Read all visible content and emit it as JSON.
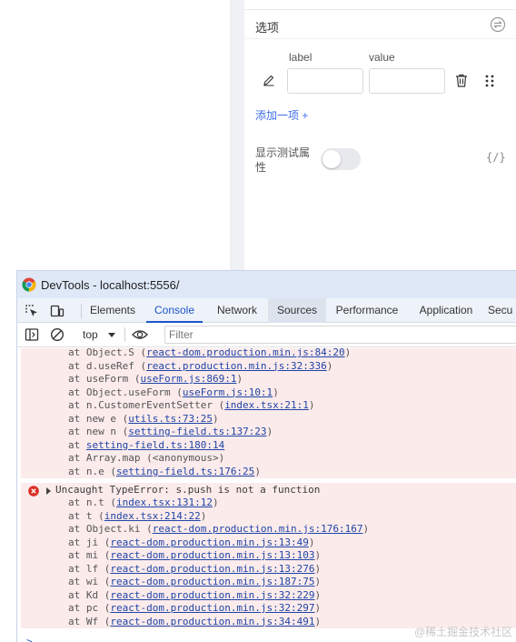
{
  "panel": {
    "section_title": "选项",
    "column_label": "label",
    "column_value": "value",
    "add_link": "添加一项 +",
    "toggle_label": "显示测试属性",
    "toggle_on": false,
    "code_icon_text": "{/}"
  },
  "devtools": {
    "title": "DevTools - localhost:5556/",
    "tabs": [
      "Elements",
      "Console",
      "Network",
      "Sources",
      "Performance",
      "Application",
      "Secu"
    ],
    "active_tab": "Console",
    "context": "top",
    "filter_placeholder": "Filter"
  },
  "console": {
    "block1": [
      {
        "pre": "at Object.S (",
        "link": "react-dom.production.min.js:84:20",
        "post": ")"
      },
      {
        "pre": "at d.useRef (",
        "link": "react.production.min.js:32:336",
        "post": ")"
      },
      {
        "pre": "at useForm (",
        "link": "useForm.js:869:1",
        "post": ")"
      },
      {
        "pre": "at Object.useForm (",
        "link": "useForm.js:10:1",
        "post": ")"
      },
      {
        "pre": "at n.CustomerEventSetter (",
        "link": "index.tsx:21:1",
        "post": ")"
      },
      {
        "pre": "at new e (",
        "link": "utils.ts:73:25",
        "post": ")"
      },
      {
        "pre": "at new n (",
        "link": "setting-field.ts:137:23",
        "post": ")"
      },
      {
        "pre": "at ",
        "link": "setting-field.ts:180:14",
        "post": ""
      },
      {
        "pre": "at Array.map (<anonymous>)",
        "link": "",
        "post": ""
      },
      {
        "pre": "at n.e (",
        "link": "setting-field.ts:176:25",
        "post": ")"
      }
    ],
    "error_message": "Uncaught TypeError: s.push is not a function",
    "block2": [
      {
        "pre": "at n.t (",
        "link": "index.tsx:131:12",
        "post": ")"
      },
      {
        "pre": "at t (",
        "link": "index.tsx:214:22",
        "post": ")"
      },
      {
        "pre": "at Object.ki (",
        "link": "react-dom.production.min.js:176:167",
        "post": ")"
      },
      {
        "pre": "at ji (",
        "link": "react-dom.production.min.js:13:49",
        "post": ")"
      },
      {
        "pre": "at mi (",
        "link": "react-dom.production.min.js:13:103",
        "post": ")"
      },
      {
        "pre": "at lf (",
        "link": "react-dom.production.min.js:13:276",
        "post": ")"
      },
      {
        "pre": "at wi (",
        "link": "react-dom.production.min.js:187:75",
        "post": ")"
      },
      {
        "pre": "at Kd (",
        "link": "react-dom.production.min.js:32:229",
        "post": ")"
      },
      {
        "pre": "at pc (",
        "link": "react-dom.production.min.js:32:297",
        "post": ")"
      },
      {
        "pre": "at Wf (",
        "link": "react-dom.production.min.js:34:491",
        "post": ")"
      }
    ],
    "prompt": ">"
  },
  "watermark": "@稀土掘金技术社区",
  "colors": {
    "link": "#1f45a7",
    "accent": "#1a56c8",
    "error_bg": "#fcebeb",
    "error_icon": "#d93025",
    "add_link": "#3f6fe8"
  },
  "icons": {
    "panel": [
      "collapse-icon",
      "edit-icon",
      "trash-icon",
      "drag-handle-icon",
      "code-icon"
    ],
    "devtools": [
      "chrome-icon",
      "inspect-element-icon",
      "device-toggle-icon",
      "sidebar-toggle-icon",
      "clear-console-icon",
      "eye-icon",
      "error-icon"
    ]
  }
}
